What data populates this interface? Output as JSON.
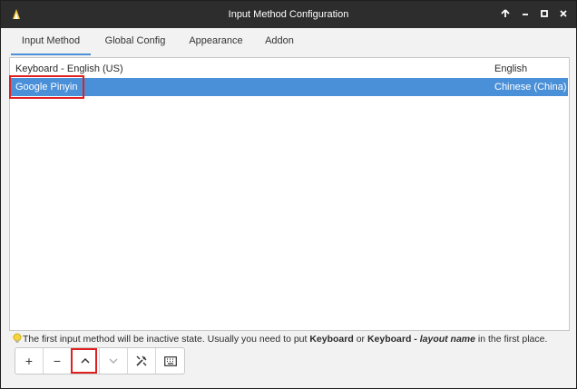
{
  "window": {
    "title": "Input Method Configuration",
    "controls": {
      "up": "🡅",
      "minimize": "–",
      "maximize": "□",
      "close": "×"
    }
  },
  "tabs": [
    {
      "label": "Input Method",
      "active": true
    },
    {
      "label": "Global Config",
      "active": false
    },
    {
      "label": "Appearance",
      "active": false
    },
    {
      "label": "Addon",
      "active": false
    }
  ],
  "input_methods": [
    {
      "name": "Keyboard - English (US)",
      "language": "English",
      "selected": false
    },
    {
      "name": "Google Pinyin",
      "language": "Chinese (China)",
      "selected": true
    }
  ],
  "hint": {
    "prefix": "The first input method will be inactive state. Usually you need to put ",
    "kw1": "Keyboard",
    "mid": " or ",
    "kw2": "Keyboard - ",
    "kw3": "layout name",
    "suffix": " in the first place."
  },
  "toolbar": {
    "add": "+",
    "remove": "−"
  },
  "colors": {
    "accent": "#4a90d9",
    "highlight": "#e02020",
    "titlebar": "#2d2d2d"
  },
  "icons": [
    "app-icon",
    "arrow-up-icon",
    "minimize-icon",
    "maximize-icon",
    "close-icon",
    "lightbulb-icon",
    "plus-icon",
    "minus-icon",
    "chevron-up-icon",
    "chevron-down-icon",
    "configure-icon",
    "keyboard-icon"
  ]
}
